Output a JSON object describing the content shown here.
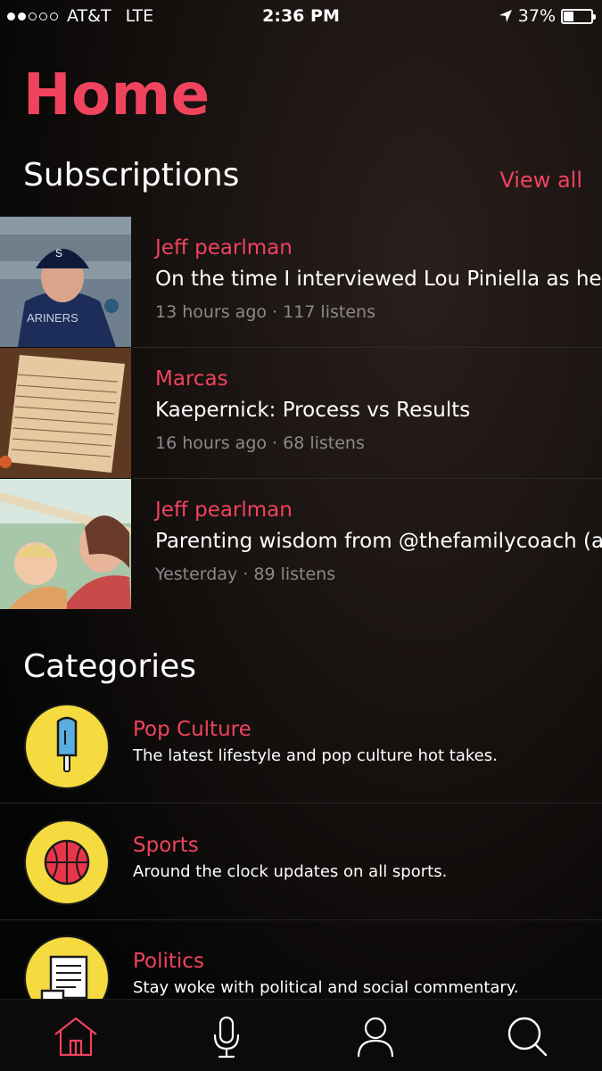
{
  "status_bar": {
    "carrier": "AT&T",
    "network": "LTE",
    "time": "2:36 PM",
    "battery": "37%",
    "signal_icon": "signal-dots-icon",
    "location_icon": "location-arrow-icon",
    "battery_icon": "battery-icon",
    "signal_bars": 2,
    "battery_level": 0.37
  },
  "page": {
    "title": "Home"
  },
  "subscriptions": {
    "heading": "Subscriptions",
    "view_all": "View all",
    "items": [
      {
        "author": "Jeff pearlman",
        "title": "On the time I interviewed Lou Piniella as he",
        "meta": "13 hours ago · 117 listens"
      },
      {
        "author": "Marcas",
        "title": "Kaepernick: Process vs Results",
        "meta": "16 hours ago · 68 listens"
      },
      {
        "author": "Jeff pearlman",
        "title": "Parenting wisdom from @thefamilycoach (a",
        "meta": "Yesterday · 89 listens"
      }
    ]
  },
  "categories": {
    "heading": "Categories",
    "items": [
      {
        "name": "Pop Culture",
        "description": "The latest lifestyle and pop culture hot takes.",
        "icon": "popsicle-icon"
      },
      {
        "name": "Sports",
        "description": "Around the clock updates on all sports.",
        "icon": "basketball-icon"
      },
      {
        "name": "Politics",
        "description": "Stay woke with political and social commentary.",
        "icon": "scroll-document-icon"
      }
    ]
  },
  "tab_bar": {
    "items": [
      {
        "icon": "home-icon",
        "active": true
      },
      {
        "icon": "microphone-icon",
        "active": false
      },
      {
        "icon": "profile-icon",
        "active": false
      },
      {
        "icon": "search-icon",
        "active": false
      }
    ]
  },
  "colors": {
    "accent": "#f0435e",
    "category_icon_bg": "#f5db3f",
    "secondary_text": "#8a8a8a",
    "tab_icon": "#ffffff"
  }
}
